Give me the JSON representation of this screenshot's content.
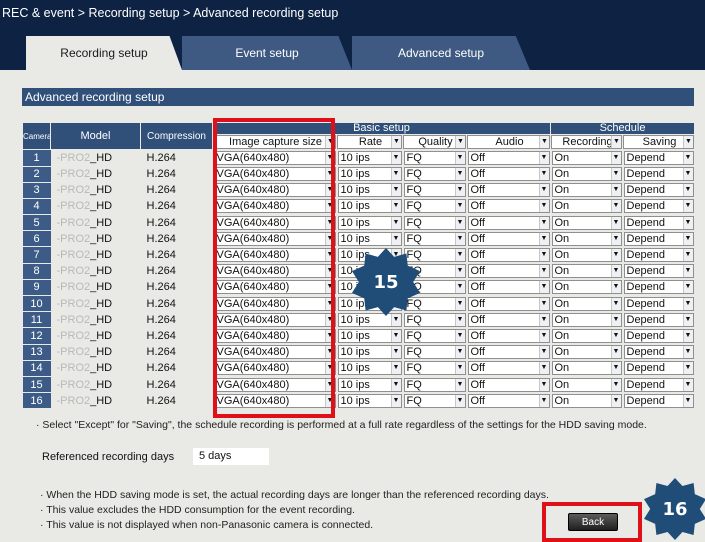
{
  "breadcrumb": "REC & event > Recording setup > Advanced recording setup",
  "tabs": [
    {
      "label": "Recording setup"
    },
    {
      "label": "Event setup"
    },
    {
      "label": "Advanced setup"
    }
  ],
  "section_title": "Advanced recording setup",
  "table": {
    "headers": {
      "camera": "Camera",
      "model": "Model",
      "compression": "Compression",
      "basic_setup": "Basic setup",
      "schedule": "Schedule",
      "image_capture_size": "Image capture size",
      "rate": "Rate",
      "quality": "Quality",
      "audio": "Audio",
      "recording": "Recording",
      "saving": "Saving"
    },
    "rows": [
      {
        "camera": "1",
        "model_prefix": "-PRO2",
        "model_suffix": "_HD",
        "compression": "H.264",
        "size": "VGA(640x480)",
        "rate": "10 ips",
        "quality": "FQ",
        "audio": "Off",
        "recording": "On",
        "saving": "Depend"
      },
      {
        "camera": "2",
        "model_prefix": "-PRO2",
        "model_suffix": "_HD",
        "compression": "H.264",
        "size": "VGA(640x480)",
        "rate": "10 ips",
        "quality": "FQ",
        "audio": "Off",
        "recording": "On",
        "saving": "Depend"
      },
      {
        "camera": "3",
        "model_prefix": "-PRO2",
        "model_suffix": "_HD",
        "compression": "H.264",
        "size": "VGA(640x480)",
        "rate": "10 ips",
        "quality": "FQ",
        "audio": "Off",
        "recording": "On",
        "saving": "Depend"
      },
      {
        "camera": "4",
        "model_prefix": "-PRO2",
        "model_suffix": "_HD",
        "compression": "H.264",
        "size": "VGA(640x480)",
        "rate": "10 ips",
        "quality": "FQ",
        "audio": "Off",
        "recording": "On",
        "saving": "Depend"
      },
      {
        "camera": "5",
        "model_prefix": "-PRO2",
        "model_suffix": "_HD",
        "compression": "H.264",
        "size": "VGA(640x480)",
        "rate": "10 ips",
        "quality": "FQ",
        "audio": "Off",
        "recording": "On",
        "saving": "Depend"
      },
      {
        "camera": "6",
        "model_prefix": "-PRO2",
        "model_suffix": "_HD",
        "compression": "H.264",
        "size": "VGA(640x480)",
        "rate": "10 ips",
        "quality": "FQ",
        "audio": "Off",
        "recording": "On",
        "saving": "Depend"
      },
      {
        "camera": "7",
        "model_prefix": "-PRO2",
        "model_suffix": "_HD",
        "compression": "H.264",
        "size": "VGA(640x480)",
        "rate": "10 ips",
        "quality": "FQ",
        "audio": "Off",
        "recording": "On",
        "saving": "Depend"
      },
      {
        "camera": "8",
        "model_prefix": "-PRO2",
        "model_suffix": "_HD",
        "compression": "H.264",
        "size": "VGA(640x480)",
        "rate": "10 ips",
        "quality": "FQ",
        "audio": "Off",
        "recording": "On",
        "saving": "Depend"
      },
      {
        "camera": "9",
        "model_prefix": "-PRO2",
        "model_suffix": "_HD",
        "compression": "H.264",
        "size": "VGA(640x480)",
        "rate": "10 ips",
        "quality": "FQ",
        "audio": "Off",
        "recording": "On",
        "saving": "Depend"
      },
      {
        "camera": "10",
        "model_prefix": "-PRO2",
        "model_suffix": "_HD",
        "compression": "H.264",
        "size": "VGA(640x480)",
        "rate": "10 ips",
        "quality": "FQ",
        "audio": "Off",
        "recording": "On",
        "saving": "Depend"
      },
      {
        "camera": "11",
        "model_prefix": "-PRO2",
        "model_suffix": "_HD",
        "compression": "H.264",
        "size": "VGA(640x480)",
        "rate": "10 ips",
        "quality": "FQ",
        "audio": "Off",
        "recording": "On",
        "saving": "Depend"
      },
      {
        "camera": "12",
        "model_prefix": "-PRO2",
        "model_suffix": "_HD",
        "compression": "H.264",
        "size": "VGA(640x480)",
        "rate": "10 ips",
        "quality": "FQ",
        "audio": "Off",
        "recording": "On",
        "saving": "Depend"
      },
      {
        "camera": "13",
        "model_prefix": "-PRO2",
        "model_suffix": "_HD",
        "compression": "H.264",
        "size": "VGA(640x480)",
        "rate": "10 ips",
        "quality": "FQ",
        "audio": "Off",
        "recording": "On",
        "saving": "Depend"
      },
      {
        "camera": "14",
        "model_prefix": "-PRO2",
        "model_suffix": "_HD",
        "compression": "H.264",
        "size": "VGA(640x480)",
        "rate": "10 ips",
        "quality": "FQ",
        "audio": "Off",
        "recording": "On",
        "saving": "Depend"
      },
      {
        "camera": "15",
        "model_prefix": "-PRO2",
        "model_suffix": "_HD",
        "compression": "H.264",
        "size": "VGA(640x480)",
        "rate": "10 ips",
        "quality": "FQ",
        "audio": "Off",
        "recording": "On",
        "saving": "Depend"
      },
      {
        "camera": "16",
        "model_prefix": "-PRO2",
        "model_suffix": "_HD",
        "compression": "H.264",
        "size": "VGA(640x480)",
        "rate": "10 ips",
        "quality": "FQ",
        "audio": "Off",
        "recording": "On",
        "saving": "Depend"
      }
    ]
  },
  "notes": {
    "except_note": "· Select \"Except\" for \"Saving\", the schedule recording is performed at a full rate regardless of the settings for the HDD saving mode.",
    "hdd_mode_note": "· When the HDD saving mode is set, the actual recording days are longer than the referenced recording days.",
    "excludes_note": "· This value excludes the HDD consumption for the event recording.",
    "non_panasonic_note": "· This value is not displayed when non-Panasonic camera is connected."
  },
  "referenced_recording_days": {
    "label": "Referenced recording days",
    "value": "5 days"
  },
  "back_label": "Back",
  "callouts": [
    {
      "number": "15",
      "color": "#1f4d78"
    },
    {
      "number": "16",
      "color": "#1f4d78"
    }
  ],
  "colors": {
    "header_bar": "#0e2243",
    "panel_bg": "#e9e9e5",
    "table_header": "#30507a",
    "highlight": "#e0101a"
  }
}
